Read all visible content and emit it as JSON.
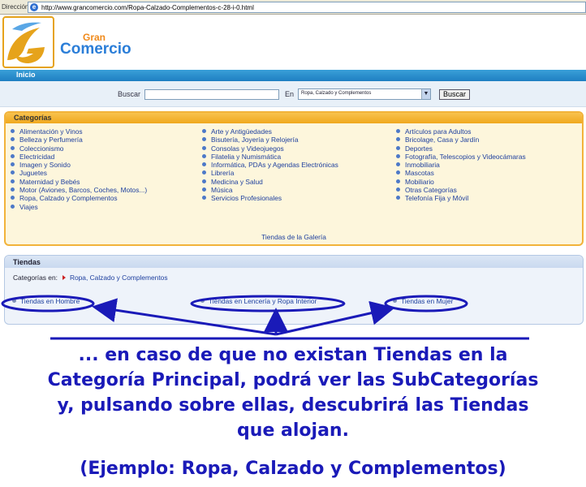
{
  "browser": {
    "address_label": "Dirección",
    "url": "http://www.grancomercio.com/Ropa-Calzado-Complementos-c-28-i-0.html"
  },
  "header": {
    "brand_top": "Gran",
    "brand_bottom": "Comercio",
    "nav_home": "Inicio",
    "colors": {
      "brand_orange": "#f08a1a",
      "brand_blue": "#2b7ed8",
      "nav_blue": "#1e7fc2"
    }
  },
  "search": {
    "label": "Buscar",
    "value": "",
    "in_label": "En",
    "selected_category": "Ropa, Calzado y Complementos",
    "button": "Buscar"
  },
  "categories": {
    "title": "Categorías",
    "col1": [
      "Alimentación y Vinos",
      "Belleza y Perfumería",
      "Coleccionismo",
      "Electricidad",
      "Imagen y Sonido",
      "Juguetes",
      "Maternidad y Bebés",
      "Motor (Aviones, Barcos, Coches, Motos...)",
      "Ropa, Calzado y Complementos",
      "Viajes"
    ],
    "col2": [
      "Arte y Antigüedades",
      "Bisutería, Joyería y Relojería",
      "Consolas y Videojuegos",
      "Filatelia y Numismática",
      "Informática, PDAs y Agendas Electrónicas",
      "Librería",
      "Medicina y Salud",
      "Música",
      "Servicios Profesionales"
    ],
    "col3": [
      "Artículos para Adultos",
      "Bricolage, Casa y Jardín",
      "Deportes",
      "Fotografía, Telescopios y Videocámaras",
      "Inmobiliaria",
      "Mascotas",
      "Mobiliario",
      "Otras Categorías",
      "Telefonía Fija y Móvil"
    ],
    "gallery_link": "Tiendas de la Galería"
  },
  "tiendas": {
    "title": "Tiendas",
    "breadcrumb_label": "Categorías en:",
    "breadcrumb_link": "Ropa, Calzado y Complementos",
    "subcategories": [
      "Tiendas en Hombre",
      "Tiendas en Lencería y Ropa Interior",
      "Tiendas en Mujer"
    ]
  },
  "caption": {
    "line1": "... en caso de que no existan Tiendas en la",
    "line2": "Categoría Principal, podrá ver las SubCategorías",
    "line3": "y, pulsando sobre ellas, descubrirá las Tiendas",
    "line4": "que alojan.",
    "line5": "(Ejemplo: Ropa, Calzado y Complementos)",
    "color": "#1a1ab8"
  }
}
